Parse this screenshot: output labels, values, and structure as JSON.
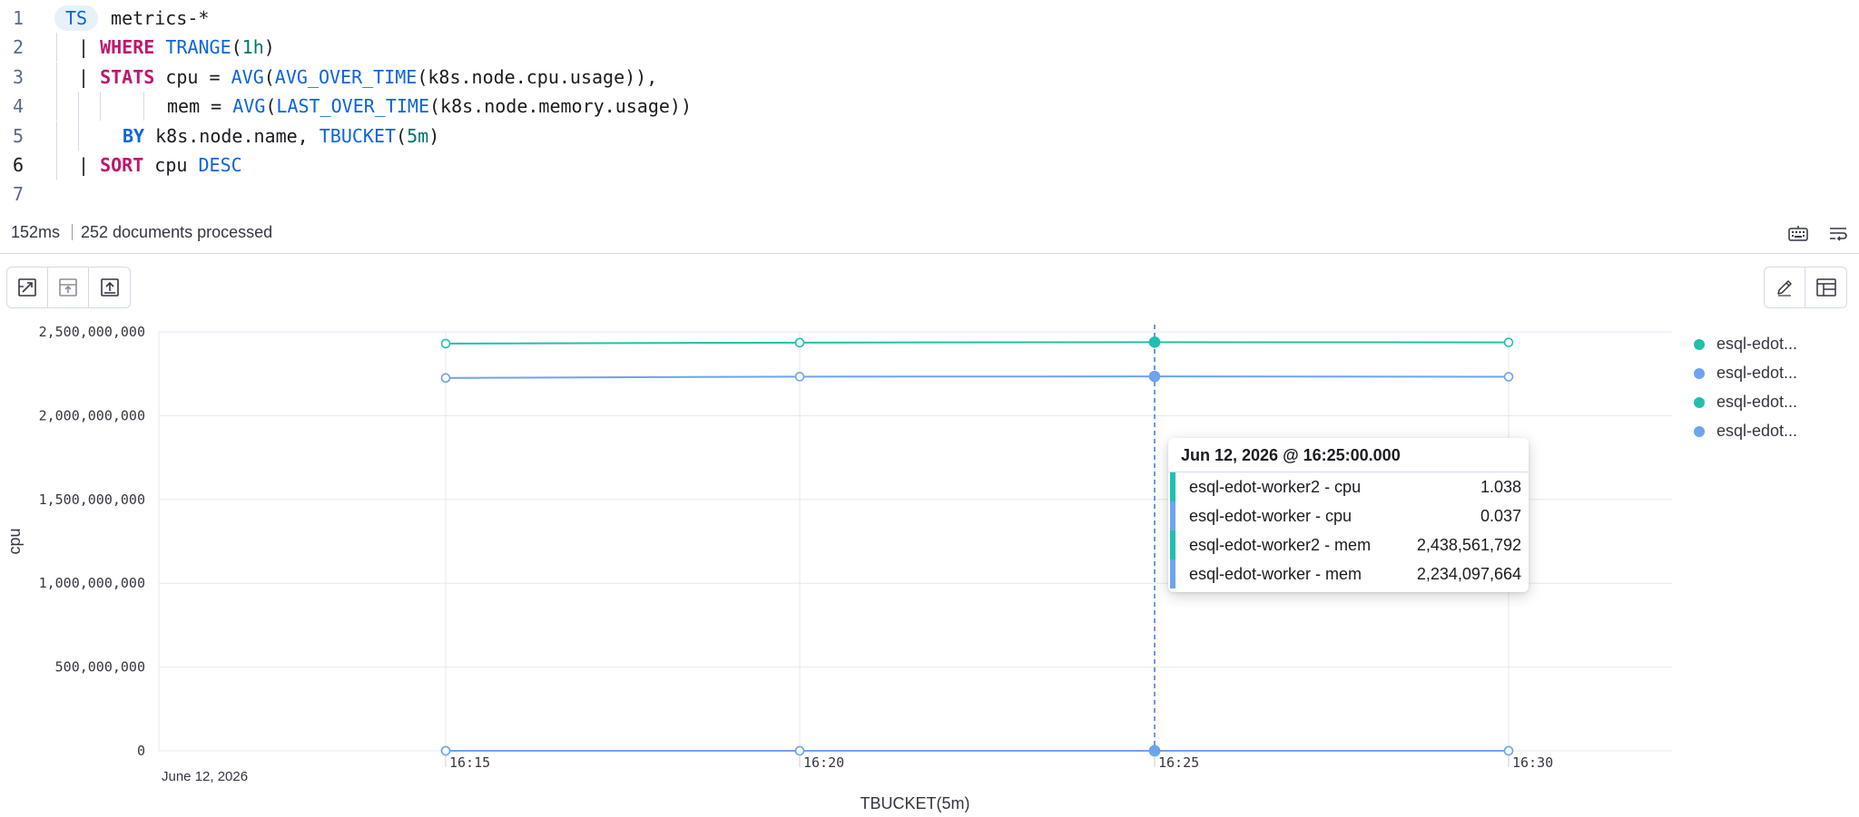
{
  "editor": {
    "ts_keyword": "TS",
    "line_numbers": [
      "1",
      "2",
      "3",
      "4",
      "5",
      "6",
      "7"
    ],
    "lines": [
      {
        "tokens": [
          {
            "t": " metrics-*",
            "c": "plain"
          }
        ]
      },
      {
        "tokens": [
          {
            "t": "| ",
            "c": "plain"
          },
          {
            "t": "WHERE",
            "c": "kw"
          },
          {
            "t": " ",
            "c": "plain"
          },
          {
            "t": "TRANGE",
            "c": "fn"
          },
          {
            "t": "(",
            "c": "plain"
          },
          {
            "t": "1h",
            "c": "num"
          },
          {
            "t": ")",
            "c": "plain"
          }
        ]
      },
      {
        "tokens": [
          {
            "t": "| ",
            "c": "plain"
          },
          {
            "t": "STATS",
            "c": "kw"
          },
          {
            "t": " cpu = ",
            "c": "plain"
          },
          {
            "t": "AVG",
            "c": "fn"
          },
          {
            "t": "(",
            "c": "plain"
          },
          {
            "t": "AVG_OVER_TIME",
            "c": "fn"
          },
          {
            "t": "(k8s.node.cpu.usage)),",
            "c": "plain"
          }
        ]
      },
      {
        "tokens": [
          {
            "t": "mem = ",
            "c": "plain"
          },
          {
            "t": "AVG",
            "c": "fn"
          },
          {
            "t": "(",
            "c": "plain"
          },
          {
            "t": "LAST_OVER_TIME",
            "c": "fn"
          },
          {
            "t": "(k8s.node.memory.usage))",
            "c": "plain"
          }
        ]
      },
      {
        "tokens": [
          {
            "t": "BY",
            "c": "kw-blue"
          },
          {
            "t": " k8s.node.name, ",
            "c": "plain"
          },
          {
            "t": "TBUCKET",
            "c": "fn"
          },
          {
            "t": "(",
            "c": "plain"
          },
          {
            "t": "5m",
            "c": "num"
          },
          {
            "t": ")",
            "c": "plain"
          }
        ]
      },
      {
        "tokens": [
          {
            "t": "| ",
            "c": "plain"
          },
          {
            "t": "SORT",
            "c": "kw"
          },
          {
            "t": " cpu ",
            "c": "plain"
          },
          {
            "t": "DESC",
            "c": "fn"
          }
        ]
      }
    ]
  },
  "status": {
    "duration": "152ms",
    "documents": "252 documents processed",
    "icons": [
      "keyboard-icon",
      "wrap-lines-icon"
    ]
  },
  "toolbar": {
    "left_buttons": [
      "expand-chart-icon",
      "collapse-chart-icon",
      "save-visualization-icon"
    ],
    "right_buttons": [
      "edit-pencil-icon",
      "layout-panel-icon"
    ]
  },
  "colors": {
    "teal": "#20c0ad",
    "blue": "#6ea3ef",
    "crosshair": "#3d78d6"
  },
  "chart_data": {
    "type": "line",
    "date_label": "June 12, 2026",
    "xlabel": "TBUCKET(5m)",
    "ylabel": "cpu",
    "x": [
      "16:15",
      "16:20",
      "16:25",
      "16:30"
    ],
    "ylim": [
      0,
      2500000000
    ],
    "yticks": [
      0,
      500000000,
      1000000000,
      1500000000,
      2000000000,
      2500000000
    ],
    "ytick_labels": [
      "0",
      "500,000,000",
      "1,000,000,000",
      "1,500,000,000",
      "2,000,000,000",
      "2,500,000,000"
    ],
    "grid": true,
    "legend_position": "right",
    "series": [
      {
        "name": "esql-edot-worker2 - cpu",
        "color": "#20c0ad",
        "values": [
          1.04,
          1.04,
          1.038,
          1.04
        ]
      },
      {
        "name": "esql-edot-worker - cpu",
        "color": "#6ea3ef",
        "values": [
          0.037,
          0.037,
          0.037,
          0.037
        ]
      },
      {
        "name": "esql-edot-worker2 - mem",
        "color": "#20c0ad",
        "values": [
          2430000000,
          2436000000,
          2438561792,
          2437000000
        ]
      },
      {
        "name": "esql-edot-worker - mem",
        "color": "#6ea3ef",
        "values": [
          2225000000,
          2233000000,
          2234097664,
          2232000000
        ]
      }
    ],
    "highlighted_x": "16:25"
  },
  "legend": {
    "items": [
      {
        "label": "esql-edot...",
        "color": "#20c0ad"
      },
      {
        "label": "esql-edot...",
        "color": "#6ea3ef"
      },
      {
        "label": "esql-edot...",
        "color": "#20c0ad"
      },
      {
        "label": "esql-edot...",
        "color": "#6ea3ef"
      }
    ]
  },
  "tooltip": {
    "title": "Jun 12, 2026 @ 16:25:00.000",
    "rows": [
      {
        "label": "esql-edot-worker2 - cpu",
        "value": "1.038",
        "color": "#20c0ad"
      },
      {
        "label": "esql-edot-worker - cpu",
        "value": "0.037",
        "color": "#6ea3ef"
      },
      {
        "label": "esql-edot-worker2 - mem",
        "value": "2,438,561,792",
        "color": "#20c0ad"
      },
      {
        "label": "esql-edot-worker - mem",
        "value": "2,234,097,664",
        "color": "#6ea3ef"
      }
    ]
  }
}
